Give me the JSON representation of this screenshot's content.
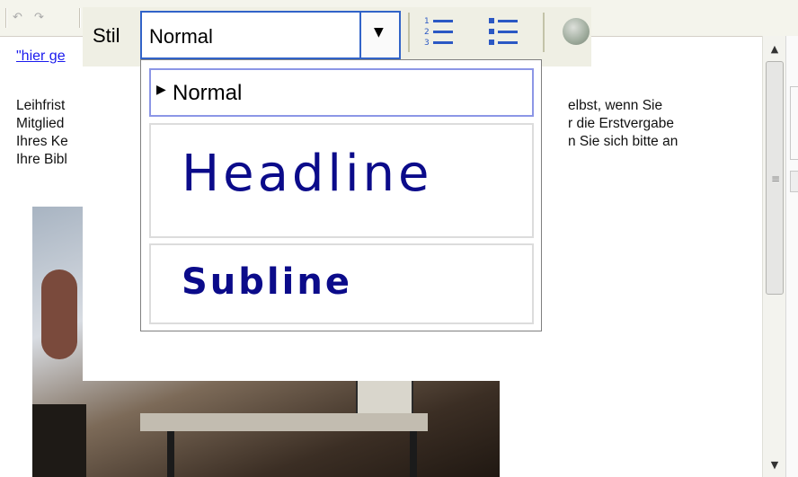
{
  "toolbar": {
    "undo_icon": "undo-icon",
    "redo_icon": "redo-icon",
    "style_label": "Stil",
    "style_value": "Normal",
    "icons": [
      "numbered-list-icon",
      "bullet-list-icon",
      "globe-link-icon"
    ]
  },
  "document": {
    "link_text": "\"hier ge",
    "left_lines": [
      "Leihfrist",
      "Mitglied",
      "Ihres Ke",
      "Ihre Bibl"
    ],
    "right_lines": [
      "elbst, wenn Sie",
      "r die Erstvergabe",
      "n Sie sich bitte an",
      ""
    ]
  },
  "style_dropdown": {
    "items": [
      {
        "label": "Normal",
        "selected": true
      },
      {
        "label": "Headline",
        "selected": false
      },
      {
        "label": "Subline",
        "selected": false
      }
    ]
  },
  "colors": {
    "accent": "#3163c8",
    "style_text": "#0b0b8a",
    "link": "#1a1aee"
  }
}
